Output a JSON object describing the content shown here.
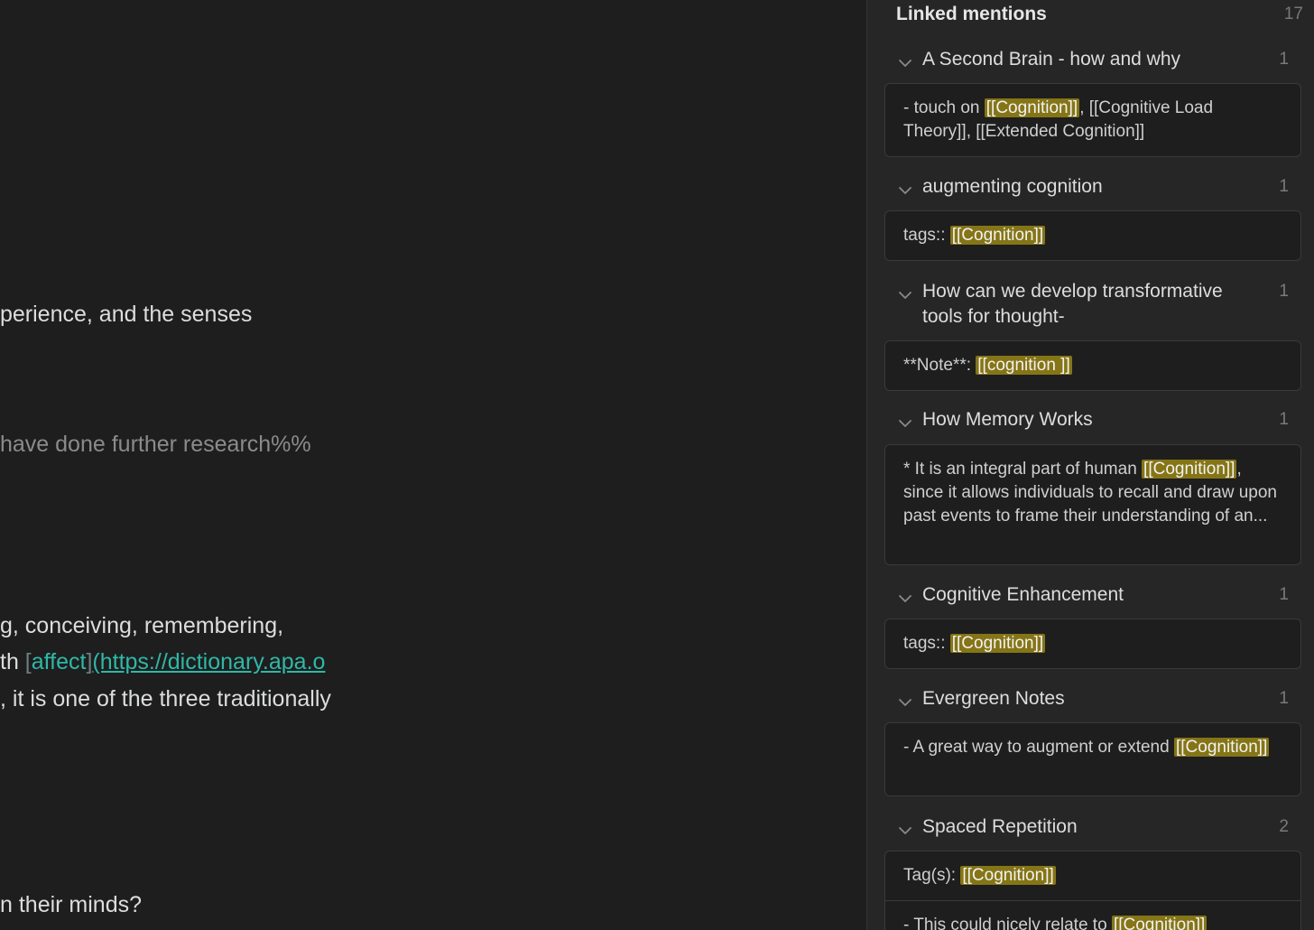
{
  "editor": {
    "lines": [
      {
        "id": "l1",
        "parts": [
          {
            "t": "perience, and the senses",
            "c": ""
          }
        ]
      },
      {
        "id": "l2",
        "parts": [
          {
            "t": "have done further research%%",
            "c": "muted"
          }
        ]
      },
      {
        "id": "l3",
        "parts": [
          {
            "t": "g, conceiving, remembering,",
            "c": ""
          }
        ]
      },
      {
        "id": "l4",
        "parts": [
          {
            "t": "th ",
            "c": ""
          },
          {
            "t": "[",
            "c": "bracket"
          },
          {
            "t": "affect",
            "c": "link-text"
          },
          {
            "t": "]",
            "c": "bracket"
          },
          {
            "t": "(https://dictionary.apa.o",
            "c": "link-url"
          }
        ]
      },
      {
        "id": "l5",
        "parts": [
          {
            "t": ", it is one of the three traditionally",
            "c": ""
          }
        ]
      },
      {
        "id": "l6",
        "parts": [
          {
            "t": "n their minds?",
            "c": ""
          }
        ]
      }
    ]
  },
  "backlinks": {
    "title": "Linked mentions",
    "count": "17",
    "groups": [
      {
        "title": "A Second Brain - how and why",
        "count": "1",
        "snippet": [
          {
            "t": "-   touch on "
          },
          {
            "t": "[[Cognition]]",
            "hl": true
          },
          {
            "t": ", [[Cognitive Load Theory]], [[Extended Cognition]]"
          }
        ]
      },
      {
        "title": "augmenting cognition",
        "count": "1",
        "snippet": [
          {
            "t": "tags:: "
          },
          {
            "t": "[[Cognition]]",
            "hl": true
          }
        ]
      },
      {
        "title": "How can we develop transformative tools for thought-",
        "count": "1",
        "snippet": [
          {
            "t": "**Note**: "
          },
          {
            "t": "[[cognition ]]",
            "hl": true
          }
        ]
      },
      {
        "title": "How Memory Works",
        "count": "1",
        "snippet": [
          {
            "t": "* It is an integral part of human "
          },
          {
            "t": "[[Cognition]]",
            "hl": true
          },
          {
            "t": ", since it allows individuals to recall and draw upon past events to frame their understanding of an..."
          }
        ]
      },
      {
        "title": "Cognitive Enhancement",
        "count": "1",
        "snippet": [
          {
            "t": "tags:: "
          },
          {
            "t": "[[Cognition]]",
            "hl": true
          }
        ]
      },
      {
        "title": "Evergreen Notes",
        "count": "1",
        "snippet": [
          {
            "t": "- A great way to augment or extend "
          },
          {
            "t": "[[Cognition]]",
            "hl": true
          }
        ]
      },
      {
        "title": "Spaced Repetition",
        "count": "2",
        "snippet": [
          {
            "t": "Tag(s): "
          },
          {
            "t": "[[Cognition]]",
            "hl": true
          }
        ],
        "snippet2": [
          {
            "t": "- This could nicely relate to "
          },
          {
            "t": "[[Cognition]]",
            "hl": true
          }
        ]
      }
    ]
  }
}
